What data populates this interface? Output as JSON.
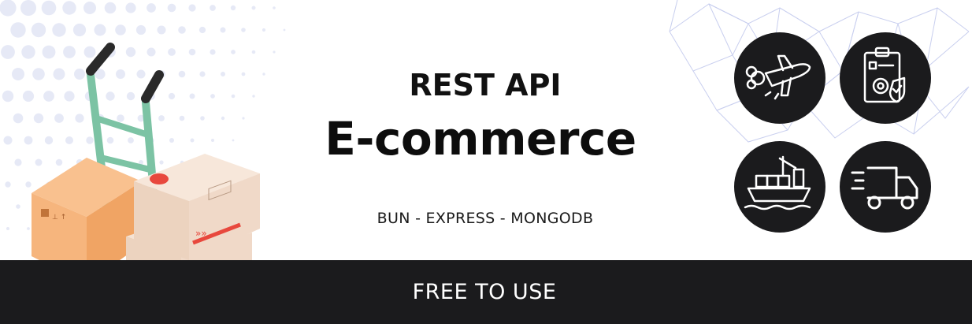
{
  "header": {
    "subtitle": "REST API",
    "title": "E-commerce",
    "stack": "BUN - EXPRESS - MONGODB"
  },
  "footer": {
    "label": "FREE TO USE"
  },
  "icons": [
    "airplane-icon",
    "checklist-gear-icon",
    "cargo-ship-icon",
    "delivery-truck-icon"
  ],
  "colors": {
    "footer_bg": "#1b1b1d",
    "circle_bg": "#1b1b1d",
    "dots": "#e6e9f6",
    "network_lines": "#c9cfef",
    "box_orange": "#f6b57d",
    "box_beige": "#f0d9c8",
    "stripe_red": "#e8483d",
    "trolley_green": "#7cc3a4"
  }
}
